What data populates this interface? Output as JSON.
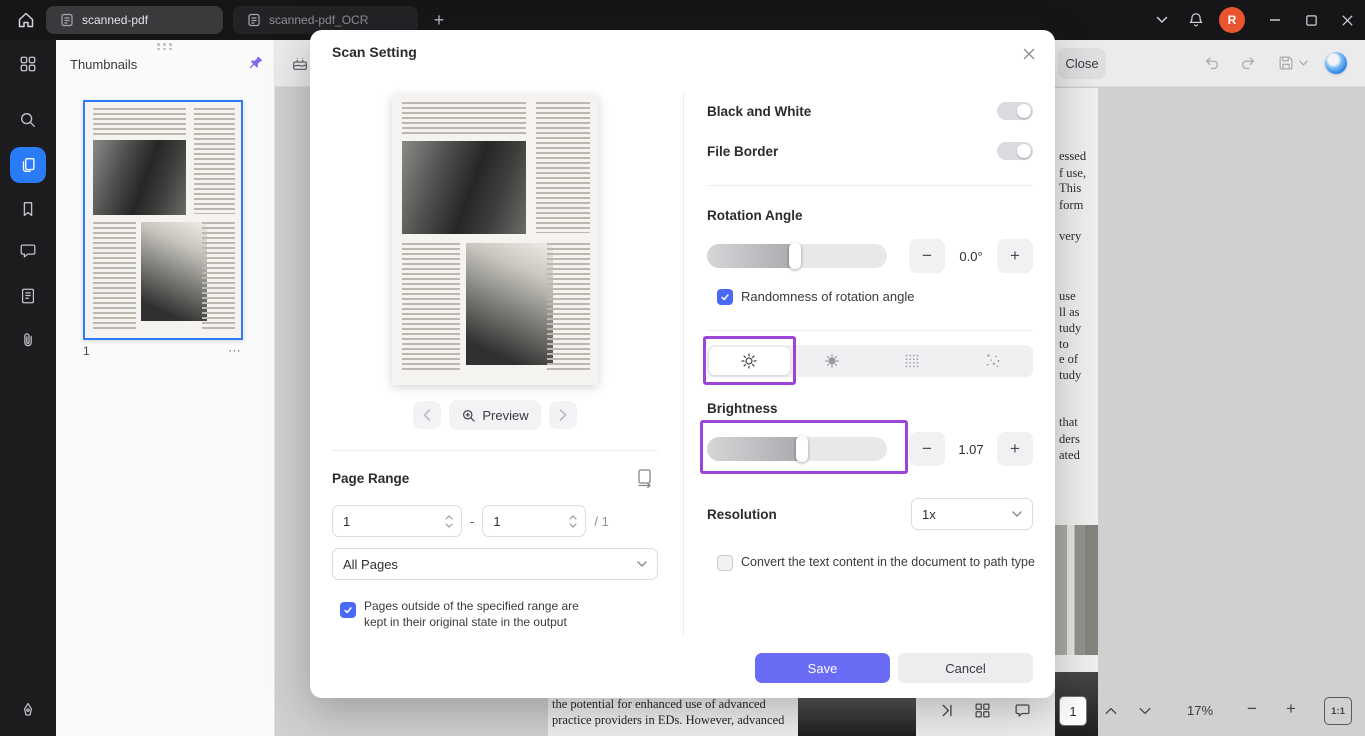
{
  "titlebar": {
    "tabs": [
      {
        "label": "scanned-pdf"
      },
      {
        "label": "scanned-pdf_OCR"
      }
    ],
    "new_tab_label": "+",
    "avatar_initial": "R"
  },
  "thumbnails": {
    "title": "Thumbnails",
    "page_label": "1",
    "more_label": "⋯"
  },
  "toolbar": {
    "close_label": "Close"
  },
  "modal": {
    "title": "Scan Setting",
    "preview_label": "Preview",
    "page_range": {
      "label": "Page Range",
      "from_value": "1",
      "to_value": "1",
      "dash": "-",
      "total_label": "/ 1",
      "scope_value": "All Pages",
      "keep_note_line1": "Pages outside of the specified range are",
      "keep_note_line2": "kept in their original state in the output"
    },
    "black_white_label": "Black and White",
    "file_border_label": "File Border",
    "rotation": {
      "label": "Rotation Angle",
      "value": "0.0°",
      "randomness_label": "Randomness of rotation angle"
    },
    "brightness": {
      "label": "Brightness",
      "value": "1.07"
    },
    "resolution": {
      "label": "Resolution",
      "value": "1x"
    },
    "convert_label": "Convert the text content in the document to path type",
    "minus": "−",
    "plus": "+",
    "save_label": "Save",
    "cancel_label": "Cancel"
  },
  "document": {
    "right_fragments": [
      "essed",
      "f use,",
      "This",
      "form",
      "very",
      "use",
      "ll as",
      "tudy",
      "to",
      "e of",
      "tudy",
      "that",
      "ders",
      "ated"
    ],
    "bottom_line1": "the potential for enhanced use of advanced",
    "bottom_line2": "practice providers in EDs. However, advanced"
  },
  "statusbar": {
    "page_value": "1",
    "zoom_value": "17%",
    "minus": "−",
    "plus": "+",
    "fit_label": "1:1"
  },
  "colors": {
    "accent_indigo": "#6a6cf6",
    "selection_blue": "#2f7bf7",
    "annotation_purple": "#9b44d8",
    "sidebar_active_blue": "#2a7bf6"
  }
}
